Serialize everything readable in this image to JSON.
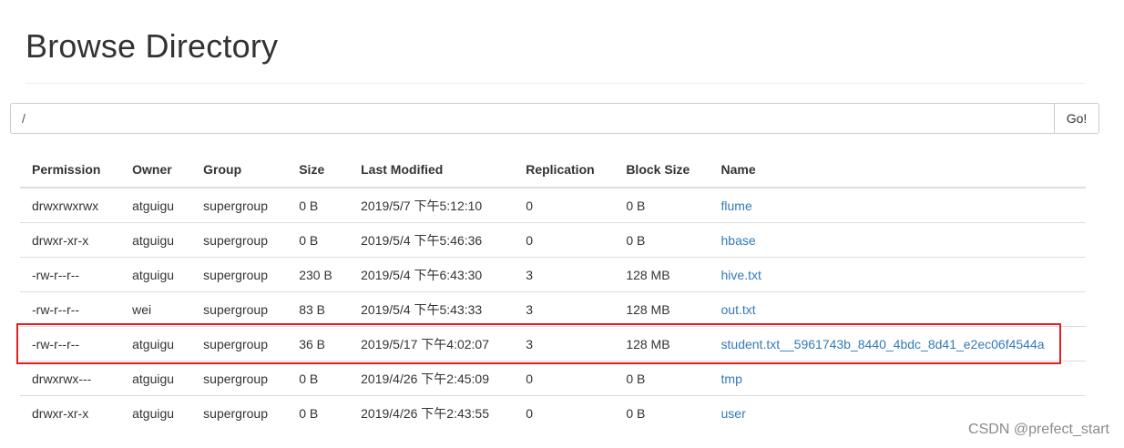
{
  "page": {
    "title": "Browse Directory",
    "path_value": "/",
    "go_label": "Go!"
  },
  "table": {
    "headers": [
      "Permission",
      "Owner",
      "Group",
      "Size",
      "Last Modified",
      "Replication",
      "Block Size",
      "Name"
    ],
    "rows": [
      [
        "drwxrwxrwx",
        "atguigu",
        "supergroup",
        "0 B",
        "2019/5/7 下午5:12:10",
        "0",
        "0 B",
        "flume"
      ],
      [
        "drwxr-xr-x",
        "atguigu",
        "supergroup",
        "0 B",
        "2019/5/4 下午5:46:36",
        "0",
        "0 B",
        "hbase"
      ],
      [
        "-rw-r--r--",
        "atguigu",
        "supergroup",
        "230 B",
        "2019/5/4 下午6:43:30",
        "3",
        "128 MB",
        "hive.txt"
      ],
      [
        "-rw-r--r--",
        "wei",
        "supergroup",
        "83 B",
        "2019/5/4 下午5:43:33",
        "3",
        "128 MB",
        "out.txt"
      ],
      [
        "-rw-r--r--",
        "atguigu",
        "supergroup",
        "36 B",
        "2019/5/17 下午4:02:07",
        "3",
        "128 MB",
        "student.txt__5961743b_8440_4bdc_8d41_e2ec06f4544a"
      ],
      [
        "drwxrwx---",
        "atguigu",
        "supergroup",
        "0 B",
        "2019/4/26 下午2:45:09",
        "0",
        "0 B",
        "tmp"
      ],
      [
        "drwxr-xr-x",
        "atguigu",
        "supergroup",
        "0 B",
        "2019/4/26 下午2:43:55",
        "0",
        "0 B",
        "user"
      ]
    ],
    "highlighted_row_index": 4
  },
  "colors": {
    "link": "#337ab7",
    "highlight_border": "#e02020"
  },
  "watermark": "CSDN @prefect_start"
}
